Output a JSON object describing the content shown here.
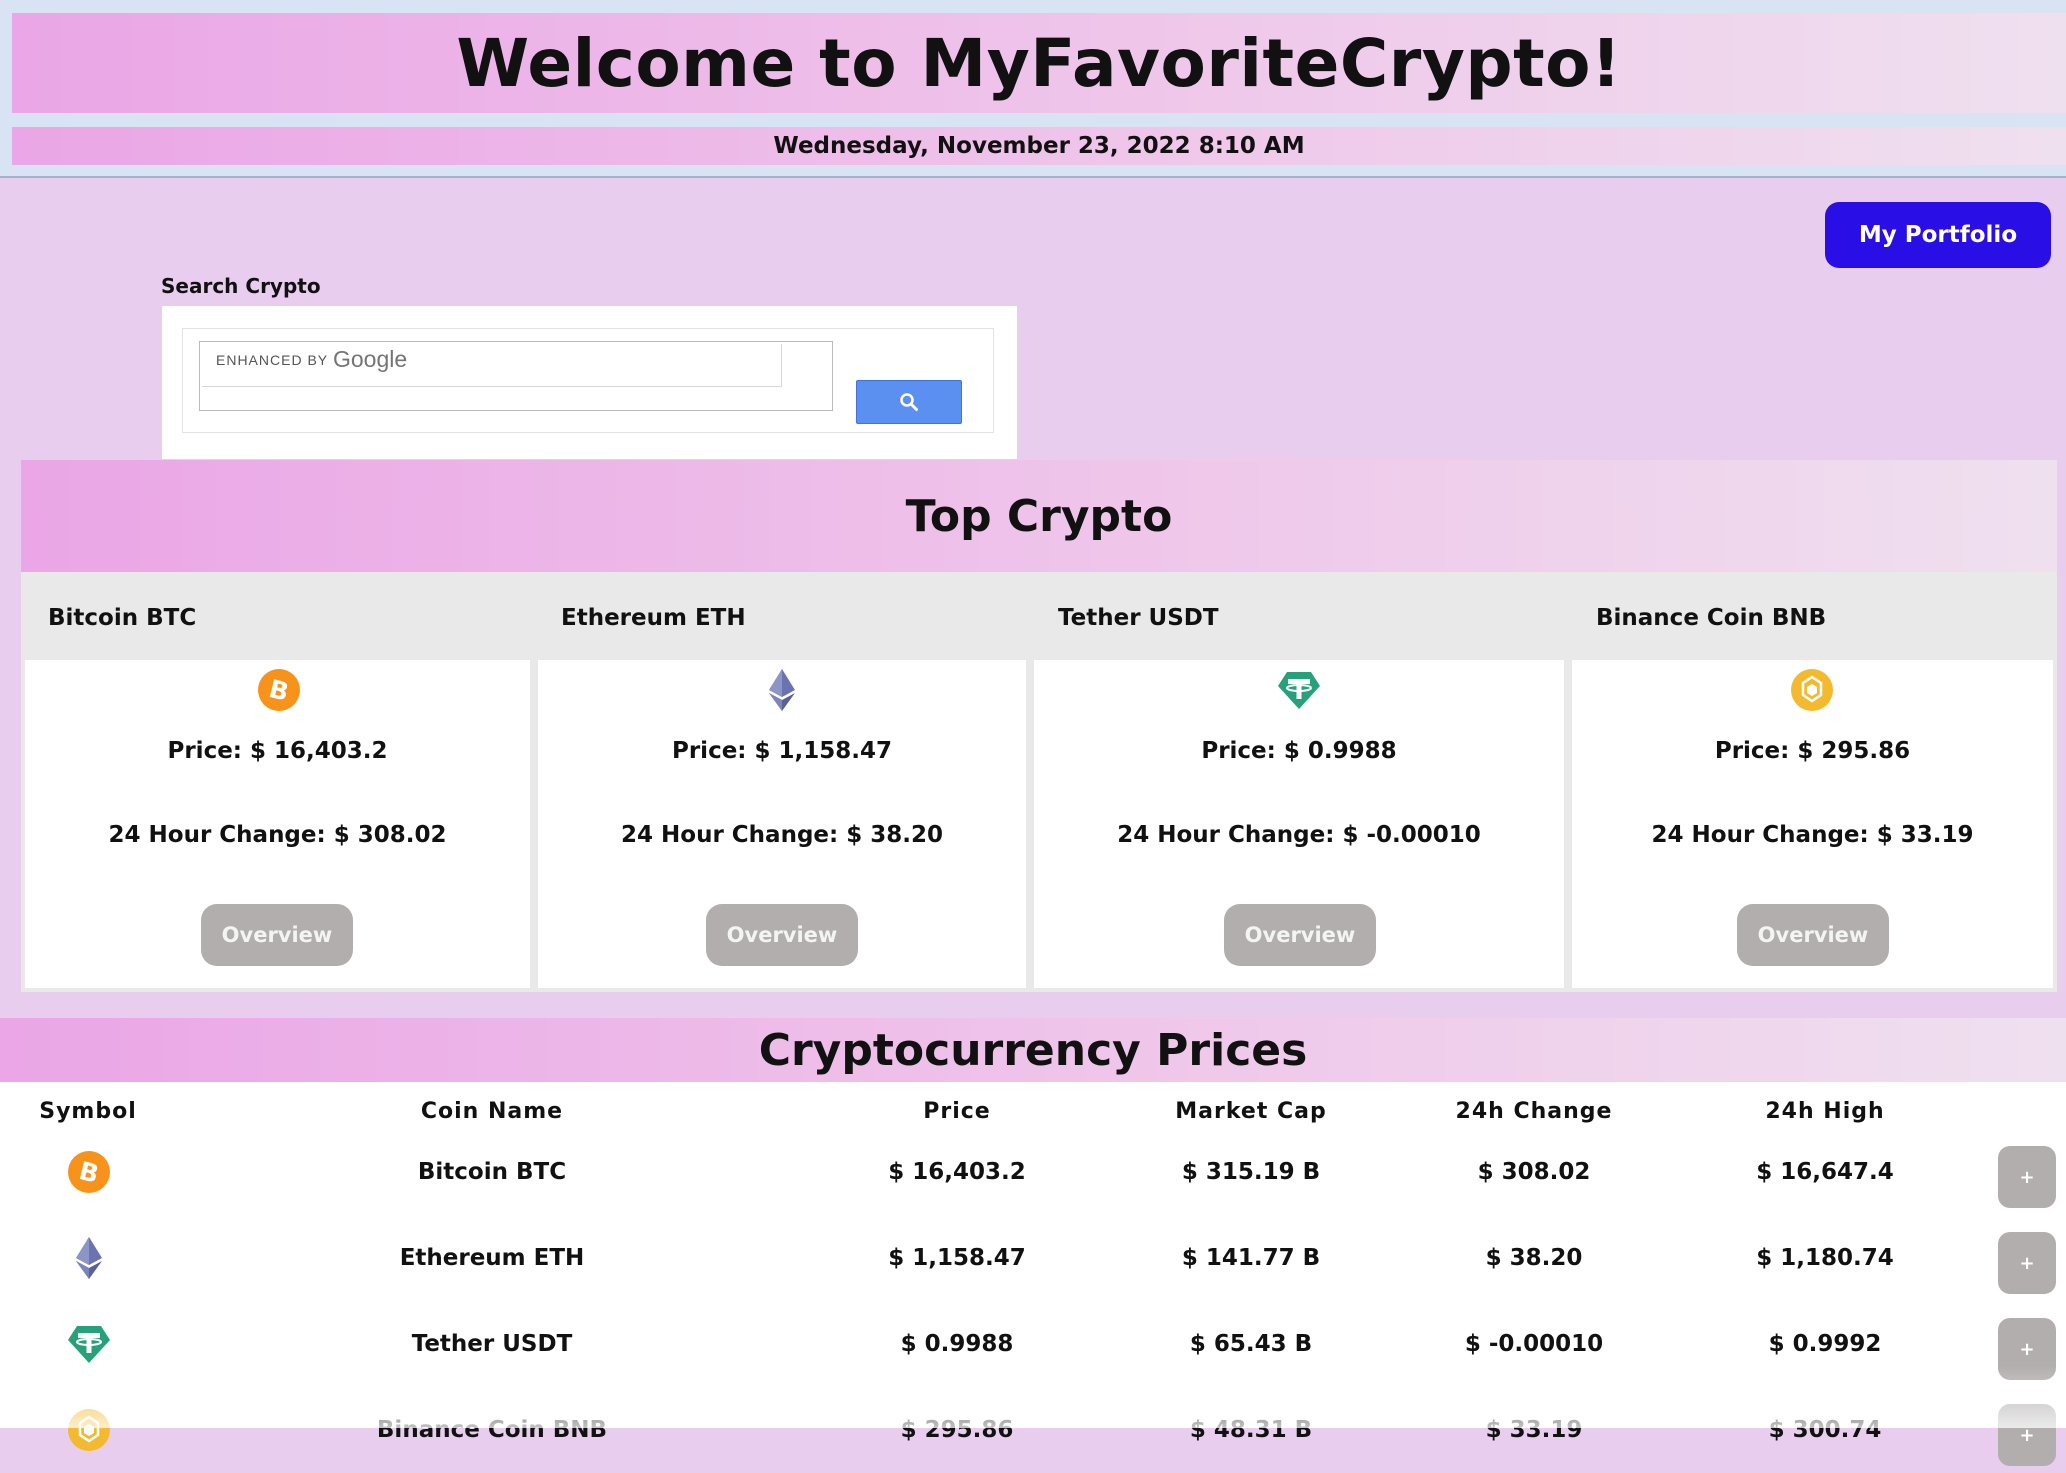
{
  "header": {
    "title": "Welcome to MyFavoriteCrypto!",
    "datetime": "Wednesday, November 23, 2022 8:10 AM"
  },
  "portfolio_button": "My Portfolio",
  "search": {
    "label": "Search Crypto",
    "enhanced_by": "ENHANCED BY",
    "brand": "Google",
    "button_icon": "search-icon"
  },
  "top_crypto": {
    "title": "Top Crypto",
    "cards": [
      {
        "name": "Bitcoin BTC",
        "icon": "bitcoin-icon",
        "price": "Price: $ 16,403.2",
        "change": "24 Hour Change: $ 308.02",
        "button": "Overview"
      },
      {
        "name": "Ethereum ETH",
        "icon": "ethereum-icon",
        "price": "Price: $ 1,158.47",
        "change": "24 Hour Change: $ 38.20",
        "button": "Overview"
      },
      {
        "name": "Tether USDT",
        "icon": "tether-icon",
        "price": "Price: $ 0.9988",
        "change": "24 Hour Change: $ -0.00010",
        "button": "Overview"
      },
      {
        "name": "Binance Coin BNB",
        "icon": "binance-icon",
        "price": "Price: $ 295.86",
        "change": "24 Hour Change: $ 33.19",
        "button": "Overview"
      }
    ]
  },
  "prices_table": {
    "title": "Cryptocurrency Prices",
    "columns": [
      "Symbol",
      "Coin Name",
      "Price",
      "Market Cap",
      "24h Change",
      "24h High"
    ],
    "add_label": "+",
    "rows": [
      {
        "icon": "bitcoin-icon",
        "name": "Bitcoin BTC",
        "price": "$ 16,403.2",
        "market_cap": "$ 315.19 B",
        "change": "$ 308.02",
        "high": "$ 16,647.4"
      },
      {
        "icon": "ethereum-icon",
        "name": "Ethereum ETH",
        "price": "$ 1,158.47",
        "market_cap": "$ 141.77 B",
        "change": "$ 38.20",
        "high": "$ 1,180.74"
      },
      {
        "icon": "tether-icon",
        "name": "Tether USDT",
        "price": "$ 0.9988",
        "market_cap": "$ 65.43 B",
        "change": "$ -0.00010",
        "high": "$ 0.9992"
      },
      {
        "icon": "binance-icon",
        "name": "Binance Coin BNB",
        "price": "$ 295.86",
        "market_cap": "$ 48.31 B",
        "change": "$ 33.19",
        "high": "$ 300.74"
      }
    ]
  },
  "colors": {
    "portfolio_button": "#2a0ee6",
    "bitcoin": "#f7931a",
    "ethereum": "#627eea",
    "tether": "#26a17b",
    "binance": "#f3ba2f",
    "overview_button": "#b2aeae"
  }
}
